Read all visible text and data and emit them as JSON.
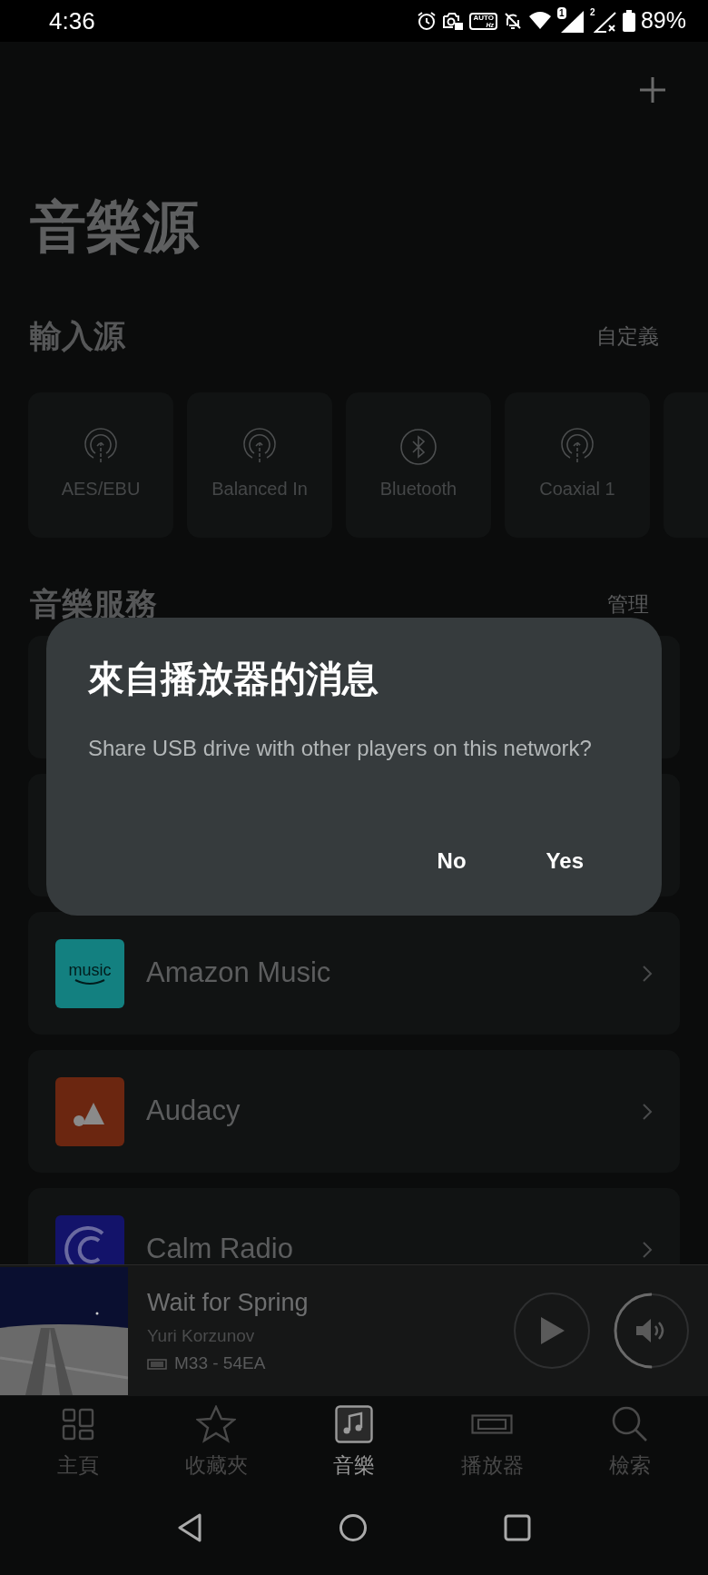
{
  "status_bar": {
    "time": "4:36",
    "auto_badge": "AUTO",
    "hz_badge": "Hz",
    "sim_1": "1",
    "sim_2": "2",
    "battery": "89%"
  },
  "page": {
    "title": "音樂源"
  },
  "inputs": {
    "heading": "輸入源",
    "action": "自定義",
    "items": [
      {
        "label": "AES/EBU",
        "kind": "input"
      },
      {
        "label": "Balanced In",
        "kind": "input"
      },
      {
        "label": "Bluetooth",
        "kind": "bluetooth"
      },
      {
        "label": "Coaxial 1",
        "kind": "input"
      },
      {
        "kind": "cut"
      }
    ]
  },
  "services": {
    "heading": "音樂服務",
    "action": "管理",
    "items": [
      {
        "kind": "hidden"
      },
      {
        "kind": "hidden"
      },
      {
        "kind": "amazon",
        "name": "Amazon Music",
        "logo_text": "music"
      },
      {
        "kind": "audacy",
        "name": "Audacy"
      },
      {
        "kind": "calm",
        "name": "Calm Radio"
      }
    ]
  },
  "dialog": {
    "title": "來自播放器的消息",
    "message": "Share USB drive with other players on this network?",
    "buttons": [
      "No",
      "Yes"
    ]
  },
  "mini_player": {
    "title": "Wait for Spring",
    "artist": "Yuri Korzunov",
    "device": "M33 - 54EA",
    "playing": false,
    "volume": {
      "level": 0.5
    }
  },
  "tabs": [
    {
      "label": "主頁",
      "kind": "home",
      "selected": false
    },
    {
      "label": "收藏夾",
      "kind": "favorites",
      "selected": false
    },
    {
      "label": "音樂",
      "kind": "music",
      "selected": true
    },
    {
      "label": "播放器",
      "kind": "player",
      "selected": false
    },
    {
      "label": "檢索",
      "kind": "search",
      "selected": false
    }
  ]
}
